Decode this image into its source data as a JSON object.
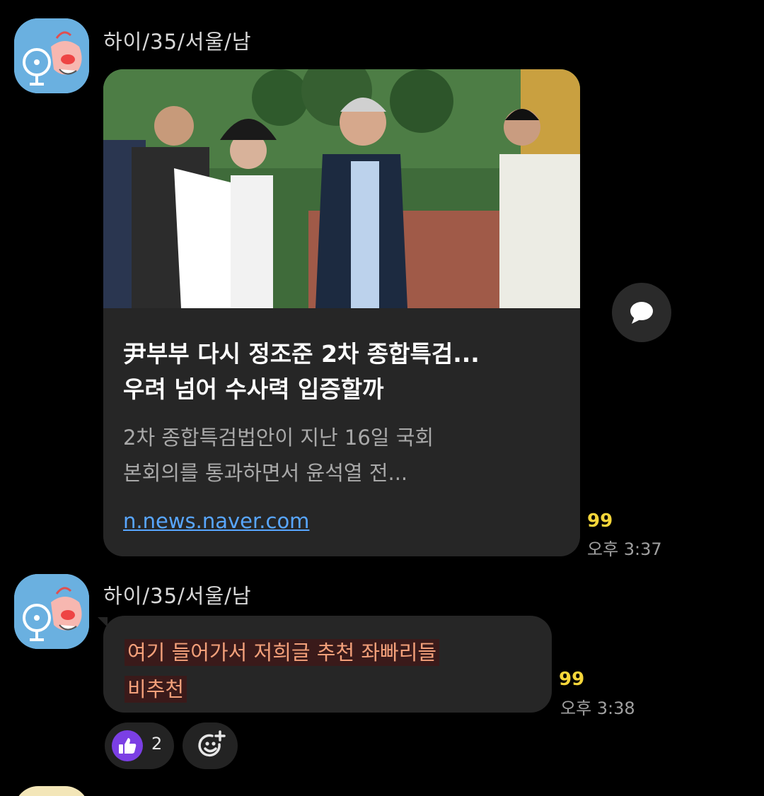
{
  "messages": [
    {
      "sender": "하이/35/서울/남",
      "avatar_icon": "fan-character-avatar-icon",
      "link_preview": {
        "image_alt": "news-photo",
        "title_line1": "尹부부 다시 정조준 2차 종합특검...",
        "title_line2": "우려 넘어 수사력 입증할까",
        "desc_line1": "2차 종합특검법안이 지난 16일 국회",
        "desc_line2": "본회의를 통과하면서 윤석열 전...",
        "domain": "n.news.naver.com"
      },
      "unread_count": "99",
      "time": "오후 3:37"
    },
    {
      "sender": "하이/35/서울/남",
      "avatar_icon": "fan-character-avatar-icon",
      "text_line1": "여기 들어가서 저희글 추천 좌빠리들",
      "text_line2": "비추천",
      "unread_count": "99",
      "time": "오후 3:38",
      "reactions": [
        {
          "icon": "thumbs-up-icon",
          "count": "2",
          "color": "#7b3fe4"
        }
      ]
    }
  ],
  "colors": {
    "background": "#000000",
    "bubble": "#262626",
    "unread": "#f5d63a",
    "link": "#58a6ff",
    "message_text": "#f3a07a"
  }
}
